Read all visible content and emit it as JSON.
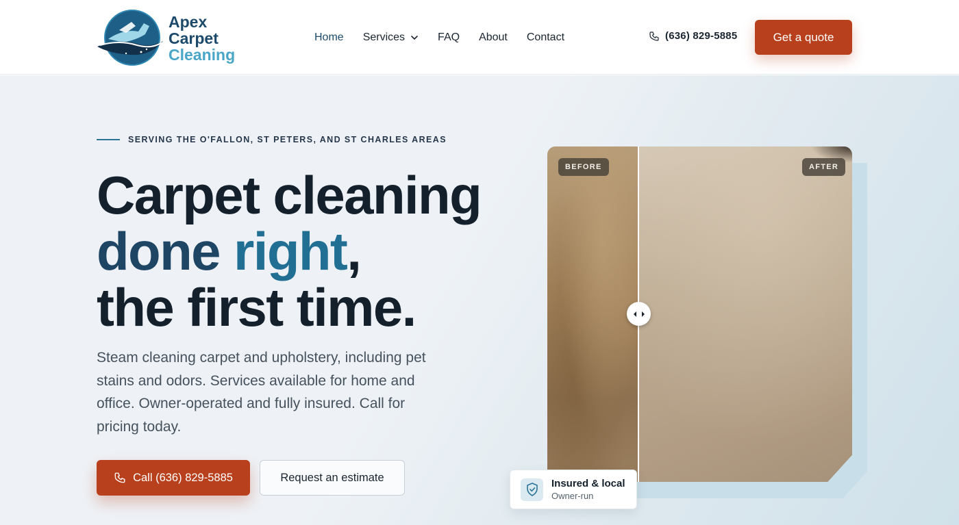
{
  "brand": {
    "line1": "Apex",
    "line2": "Carpet",
    "line3": "Cleaning",
    "colors": {
      "navy": "#1d4a6b",
      "teal": "#4aa6c7",
      "accent": "#b8401c"
    }
  },
  "nav": {
    "items": [
      {
        "label": "Home",
        "active": true
      },
      {
        "label": "Services",
        "has_dropdown": true
      },
      {
        "label": "FAQ"
      },
      {
        "label": "About"
      },
      {
        "label": "Contact"
      }
    ]
  },
  "header": {
    "phone": "(636) 829-5885",
    "phone_icon": "phone-icon",
    "quote_button": "Get a quote"
  },
  "hero": {
    "eyebrow": "SERVING THE O'FALLON, ST PETERS, AND ST CHARLES AREAS",
    "headline_line1": "Carpet cleaning",
    "headline_word_done": "done",
    "headline_word_right": "right",
    "headline_comma": ",",
    "headline_line3": "the first time.",
    "lead": "Steam cleaning carpet and upholstery, including pet stains and odors. Services available for home and office. Owner-operated and fully insured. Call for pricing today.",
    "call_button": "Call (636) 829-5885",
    "estimate_button": "Request an estimate"
  },
  "comparison": {
    "before_label": "BEFORE",
    "after_label": "AFTER",
    "handle_icon": "arrows-left-right-icon"
  },
  "badge": {
    "title": "Insured & local",
    "subtitle": "Owner-run",
    "icon": "shield-check-icon"
  }
}
